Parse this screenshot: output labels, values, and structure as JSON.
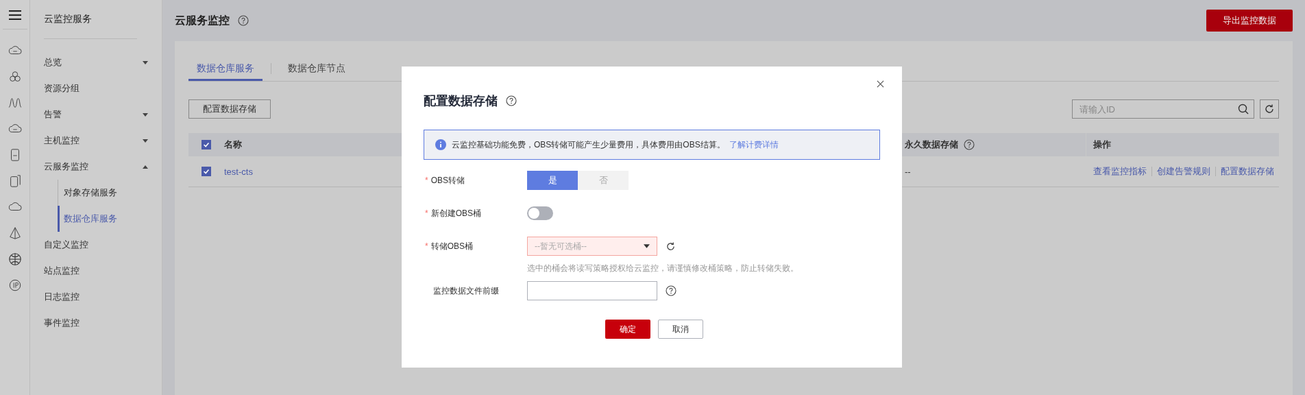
{
  "sidebar": {
    "title": "云监控服务",
    "items": [
      {
        "label": "总览",
        "expanded": false
      },
      {
        "label": "资源分组"
      },
      {
        "label": "告警",
        "expanded": false
      },
      {
        "label": "主机监控",
        "expanded": false
      },
      {
        "label": "云服务监控",
        "expanded": true,
        "children": [
          {
            "label": "对象存储服务",
            "selected": false
          },
          {
            "label": "数据仓库服务",
            "selected": true
          }
        ]
      },
      {
        "label": "自定义监控"
      },
      {
        "label": "站点监控"
      },
      {
        "label": "日志监控"
      },
      {
        "label": "事件监控"
      }
    ]
  },
  "header": {
    "title": "云服务监控",
    "export_button": "导出监控数据"
  },
  "tabs": [
    {
      "label": "数据仓库服务",
      "selected": true
    },
    {
      "label": "数据仓库节点",
      "selected": false
    }
  ],
  "toolbar": {
    "button": "配置数据存储",
    "search": {
      "placeholder": "请输入ID"
    }
  },
  "table": {
    "columns": [
      {
        "label": "名称"
      },
      {
        "label": "永久数据存储",
        "help": true
      },
      {
        "label": "操作"
      }
    ],
    "all_checked": true,
    "rows": [
      {
        "checked": true,
        "name": "test-cts",
        "storage": "--",
        "actions": [
          "查看监控指标",
          "创建告警规则",
          "配置数据存储"
        ]
      }
    ]
  },
  "dialog": {
    "title": "配置数据存储",
    "info": "云监控基础功能免费，OBS转储可能产生少量费用，具体费用由OBS结算。",
    "info_link": "了解计费详情",
    "fields": [
      {
        "kind": "segmented",
        "label": "OBS转储",
        "required_mark": "*",
        "options": [
          {
            "label": "是",
            "selected": true
          },
          {
            "label": "否",
            "selected": false
          }
        ]
      },
      {
        "kind": "toggle",
        "label": "新创建OBS桶",
        "required_mark": "*",
        "on": false
      },
      {
        "kind": "select",
        "label": "转储OBS桶",
        "required_mark": "*",
        "placeholder": "--暂无可选桶--",
        "hint": "选中的桶会将读写策略授权给云监控，请谨慎修改桶策略，防止转储失败。"
      },
      {
        "kind": "text",
        "label": "监控数据文件前缀"
      }
    ],
    "ok": "确定",
    "cancel": "取消"
  }
}
